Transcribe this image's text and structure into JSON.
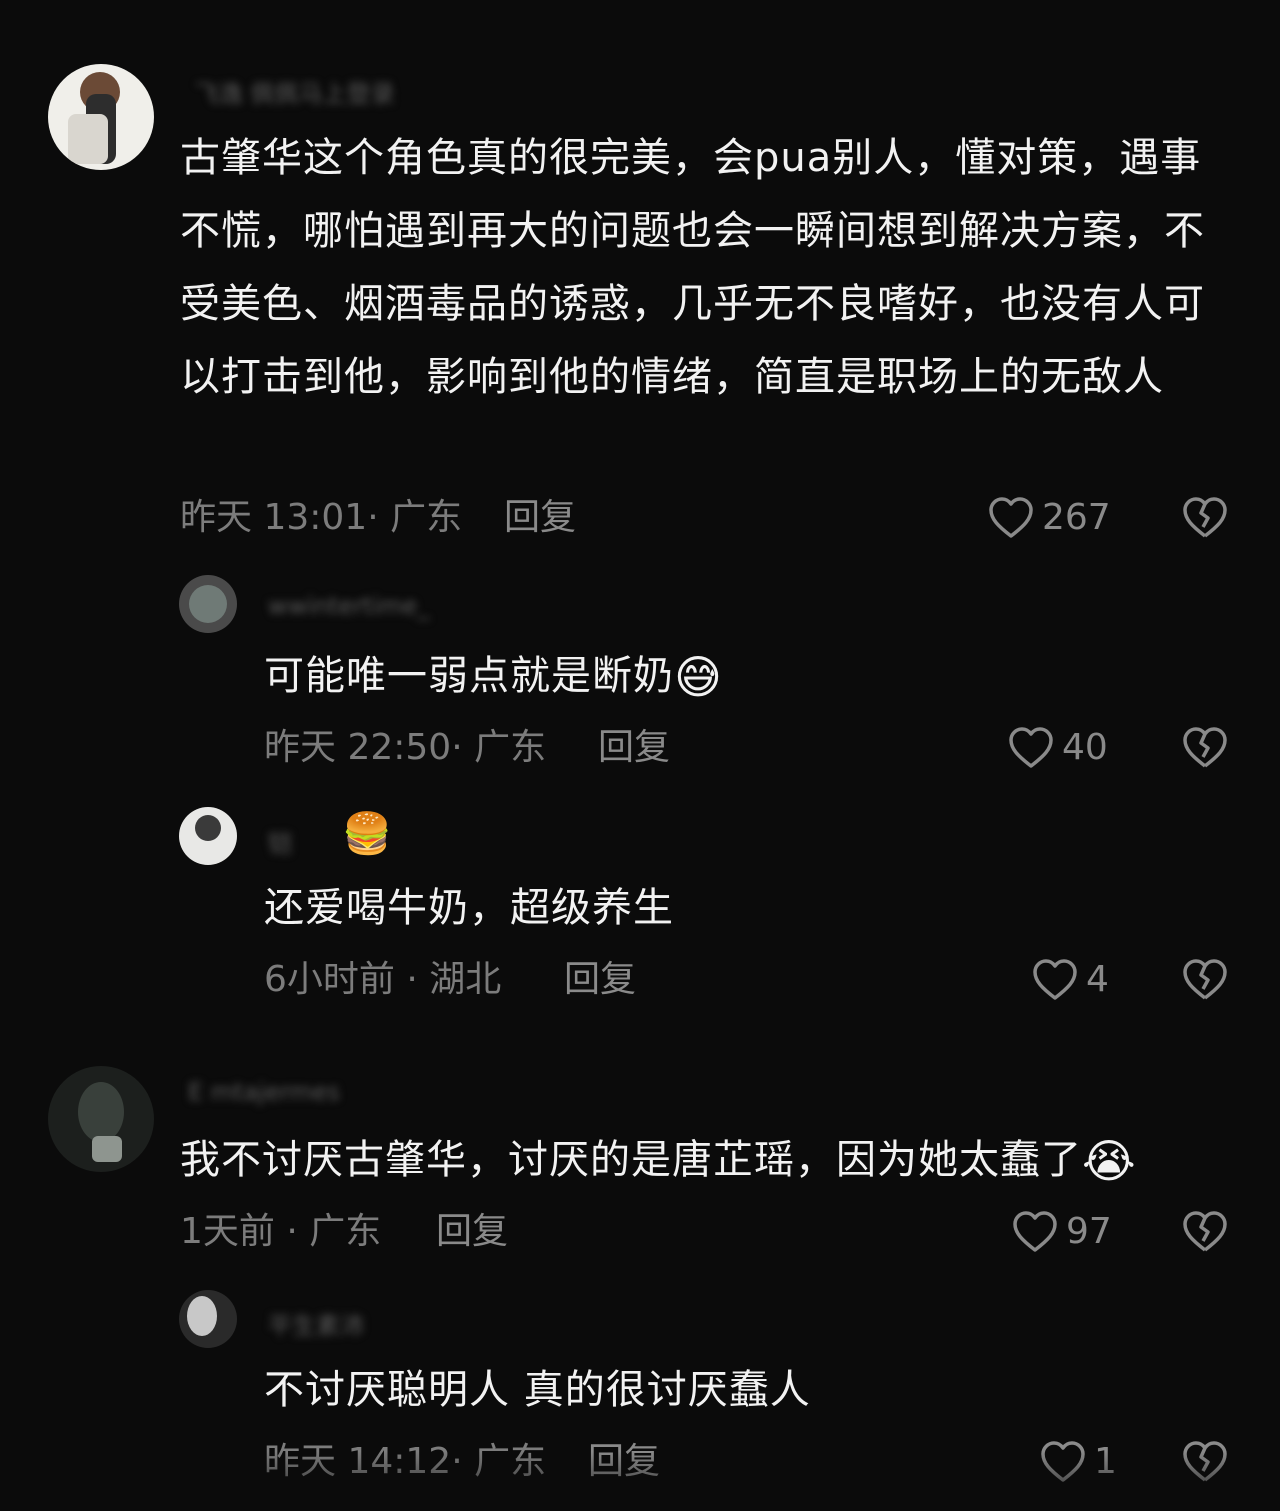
{
  "comments": [
    {
      "username": "飞逸 佩佩马上登录",
      "text": "古肇华这个角色真的很完美，会pua别人，懂对策，遇事不慌，哪怕遇到再大的问题也会一瞬间想到解决方案，不受美色、烟酒毒品的诱惑，几乎无不良嗜好，也没有人可以打击到他，影响到他的情绪，简直是职场上的无敌人",
      "time": "昨天 13:01",
      "location": "广东",
      "reply_label": "回复",
      "likes": "267",
      "replies": [
        {
          "username": "wwintertime_",
          "text": "可能唯一弱点就是断奶",
          "emoji": "😅",
          "time": "昨天 22:50",
          "location": "广东",
          "reply_label": "回复",
          "likes": "40"
        },
        {
          "username": "铠",
          "username_emoji": "🍔",
          "text": "还爱喝牛奶，超级养生",
          "time": "6小时前",
          "location": "湖北",
          "reply_label": "回复",
          "likes": "4"
        }
      ]
    },
    {
      "username": "E mtajermes",
      "text": "我不讨厌古肇华，讨厌的是唐芷瑶，因为她太蠢了",
      "emoji": "😭",
      "time": "1天前",
      "location": "广东",
      "reply_label": "回复",
      "likes": "97",
      "replies": [
        {
          "username": "平生素沛",
          "text": "不讨厌聪明人 真的很讨厌蠢人",
          "time": "昨天 14:12",
          "location": "广东",
          "reply_label": "回复",
          "likes": "1"
        }
      ]
    }
  ],
  "colors": {
    "background": "#0b0b0b",
    "text": "#f2f2f2",
    "meta": "#7c7c7c"
  },
  "icons": {
    "like": "heart-outline-icon",
    "dislike": "broken-heart-icon"
  }
}
